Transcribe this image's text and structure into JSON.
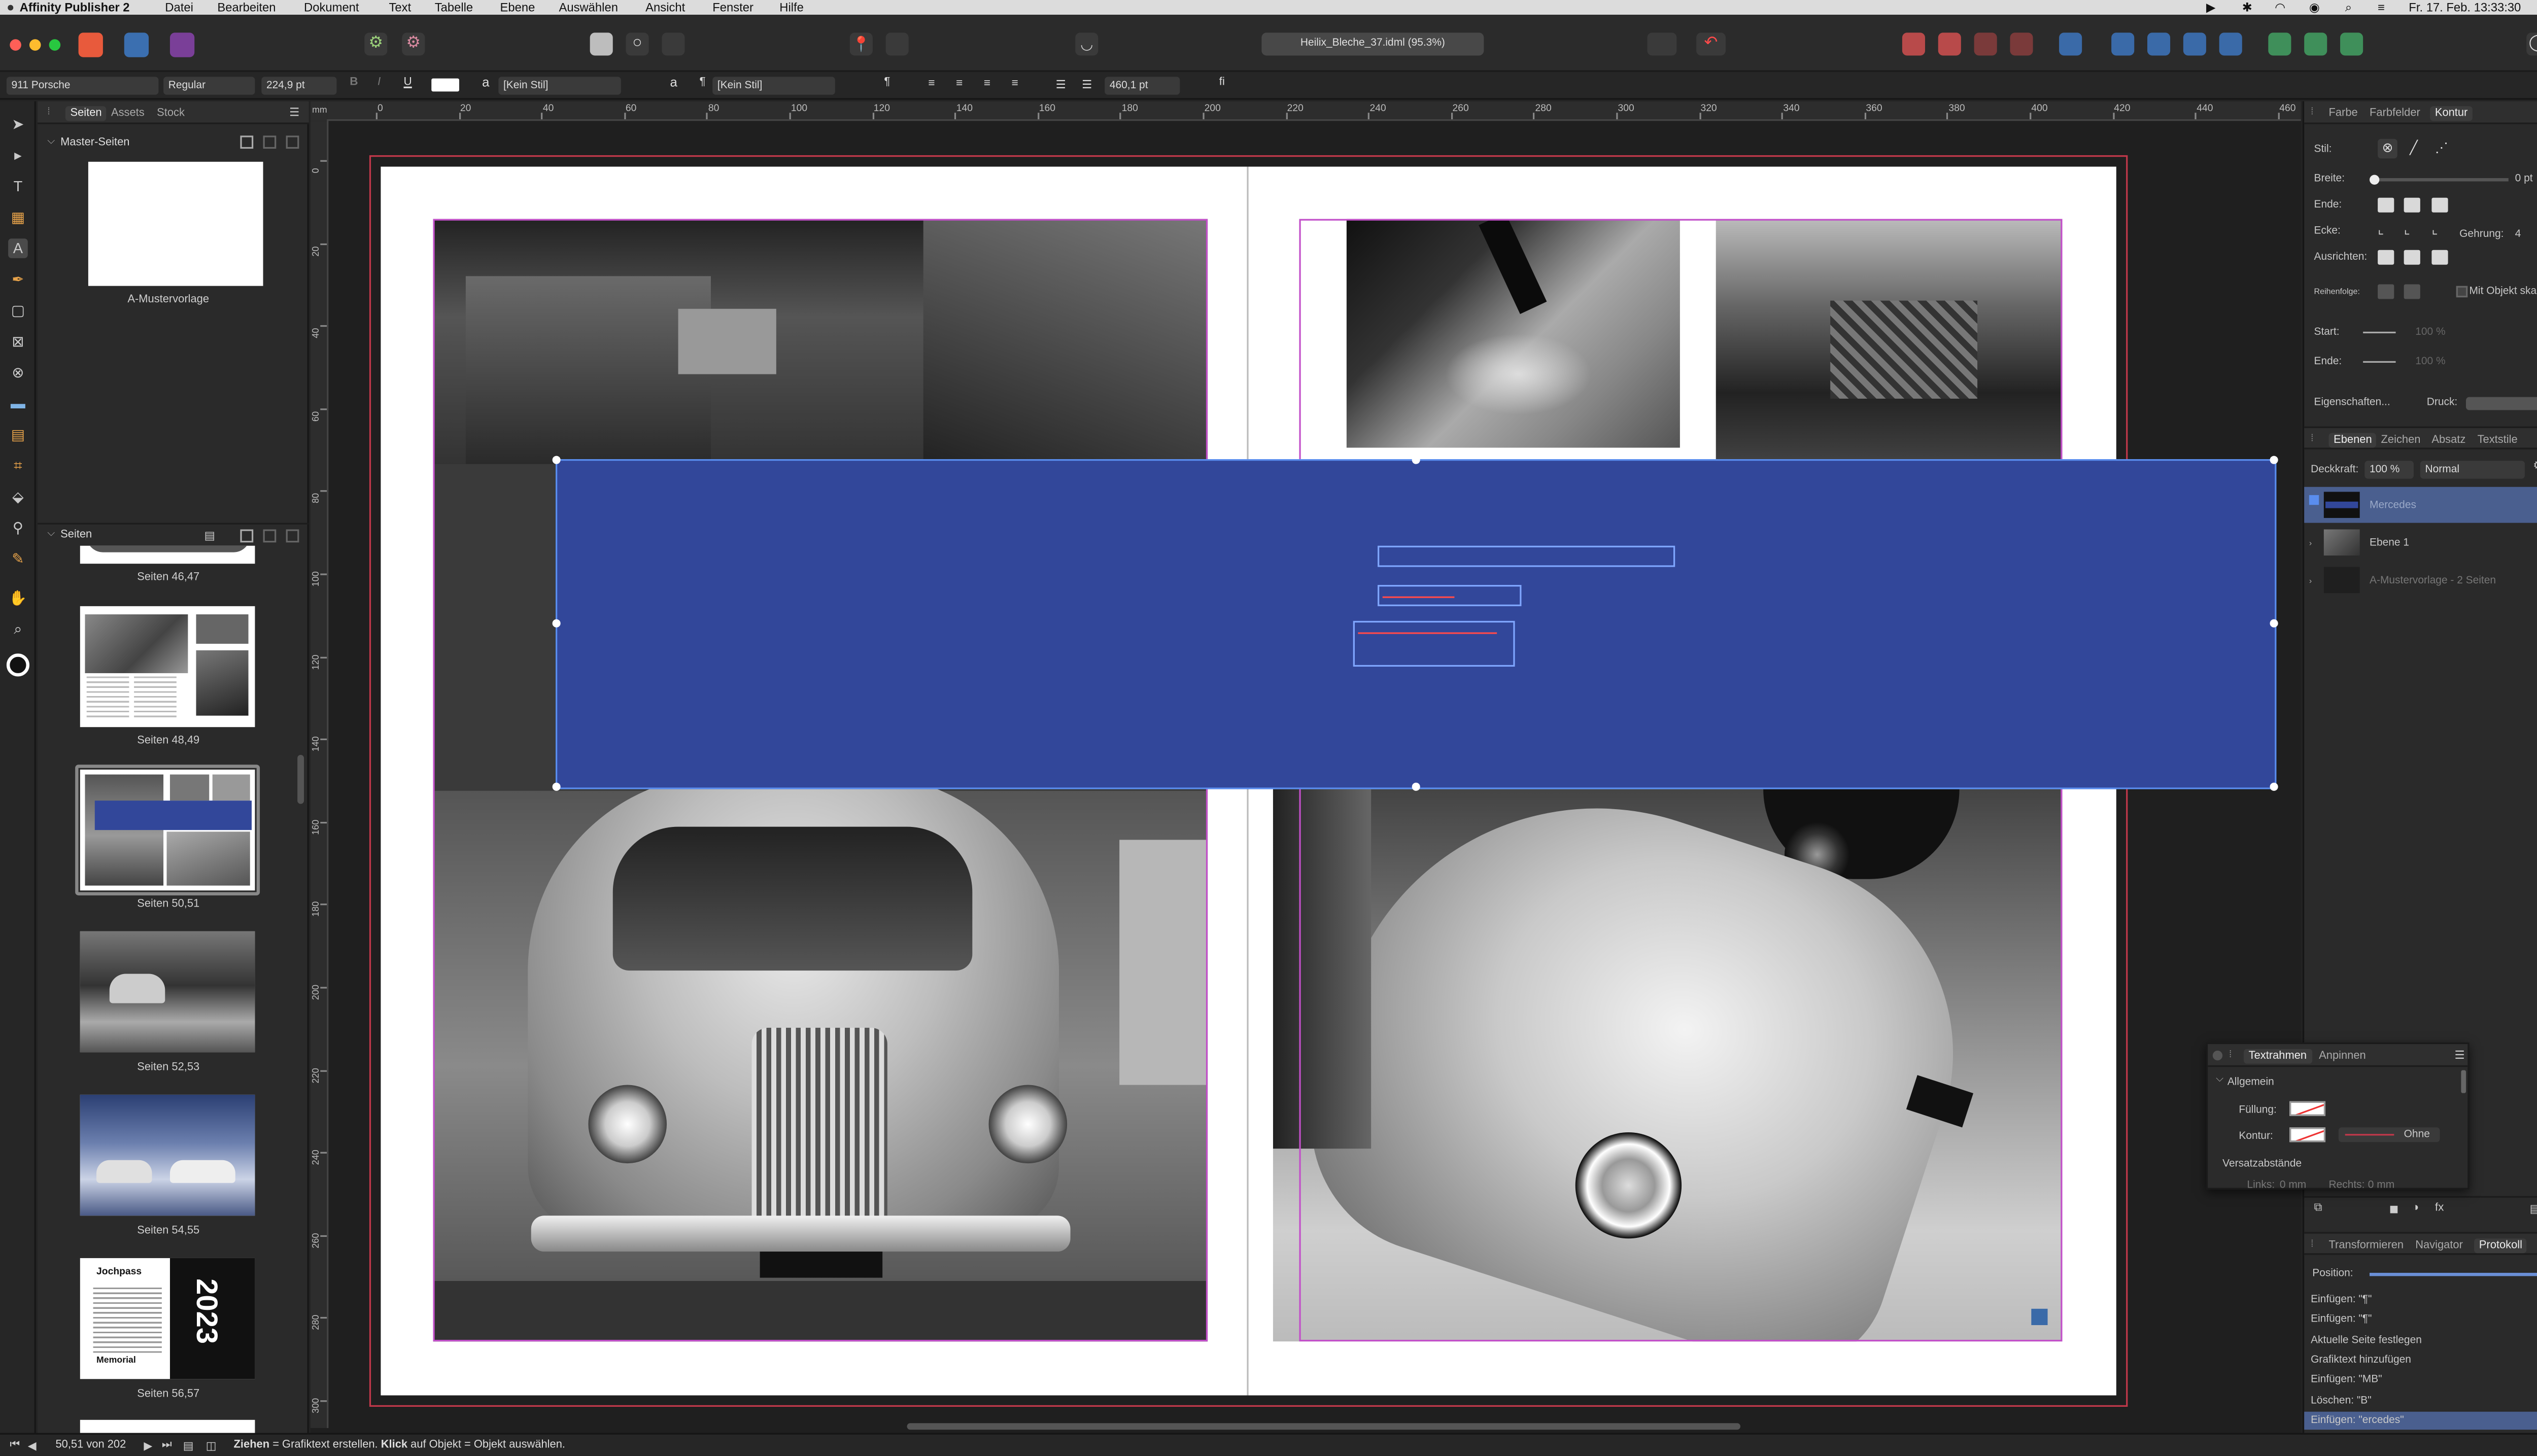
{
  "menubar": {
    "app_name": "Affinity Publisher 2",
    "items": [
      "Datei",
      "Bearbeiten",
      "Dokument",
      "Text",
      "Tabelle",
      "Ebene",
      "Auswählen",
      "Ansicht",
      "Fenster",
      "Hilfe"
    ],
    "clock": "Fr. 17. Feb.  13:33:30"
  },
  "toolbar": {
    "document_tab": "Heilix_Bleche_37.idml (95.3%)"
  },
  "context_bar": {
    "font_family": "911 Porsche",
    "font_style": "Regular",
    "font_size": "224,9 pt",
    "char_style": "[Kein Stil]",
    "para_style": "[Kein Stil]",
    "tracking": "460,1 pt",
    "bold": "B",
    "italic": "I",
    "underline": "U",
    "char_style_icon": "a",
    "para_icon": "¶",
    "ligature_label": "fi"
  },
  "left_panel": {
    "tabs": [
      "Seiten",
      "Assets",
      "Stock"
    ],
    "master_section": "Master-Seiten",
    "master_label": "A-Mustervorlage",
    "pages_section": "Seiten",
    "spreads": [
      {
        "label": "Seiten 46,47"
      },
      {
        "label": "Seiten 48,49"
      },
      {
        "label": "Seiten 50,51"
      },
      {
        "label": "Seiten 52,53"
      },
      {
        "label": "Seiten 54,55"
      },
      {
        "label": "Seiten 56,57"
      }
    ],
    "thumb_56_text": {
      "title": "Jochpass",
      "subtitle": "Memorial",
      "year": "2023"
    }
  },
  "rulers": {
    "h_ticks": [
      "0",
      "20",
      "40",
      "60",
      "80",
      "100",
      "120",
      "140",
      "160",
      "180",
      "200",
      "220",
      "240",
      "260",
      "280",
      "300",
      "320",
      "340",
      "360",
      "380",
      "400",
      "420",
      "440",
      "460"
    ],
    "v_ticks": [
      "0",
      "20",
      "40",
      "60",
      "80",
      "100",
      "120",
      "140",
      "160",
      "180",
      "200",
      "220",
      "240",
      "260",
      "280",
      "300"
    ],
    "unit": "mm"
  },
  "right_panel": {
    "top_tabs": [
      "Farbe",
      "Farbfelder",
      "Kontur"
    ],
    "stroke": {
      "stil": "Stil:",
      "breite": "Breite:",
      "breite_value": "0 pt",
      "ende": "Ende:",
      "ecke": "Ecke:",
      "gehrung": "Gehrung:",
      "gehrung_value": "4",
      "ausrichten": "Ausrichten:",
      "reihenfolge": "Reihenfolge:",
      "mit_objekt": "Mit Objekt skalieren",
      "start": "Start:",
      "start_pct": "100 %",
      "ende2": "Ende:",
      "ende_pct": "100 %",
      "eigenschaften": "Eigenschaften...",
      "druck": "Druck:"
    },
    "layer_tabs": [
      "Ebenen",
      "Zeichen",
      "Absatz",
      "Textstile"
    ],
    "opacity_label": "Deckkraft:",
    "opacity_value": "100 %",
    "blend_mode": "Normal",
    "layers": [
      "Mercedes",
      "Ebene 1",
      "A-Mustervorlage - 2 Seiten"
    ],
    "bottom_tabs": [
      "Transformieren",
      "Navigator",
      "Protokoll"
    ],
    "position_label": "Position:",
    "history": [
      "Einfügen: \"¶\"",
      "Einfügen: \"¶\"",
      "Aktuelle Seite festlegen",
      "Grafiktext hinzufügen",
      "Einfügen: \"MB\"",
      "Löschen: \"B\"",
      "Einfügen: \"ercedes\""
    ]
  },
  "text_frame_panel": {
    "tabs": [
      "Textrahmen",
      "Anpinnen"
    ],
    "section": "Allgemein",
    "fuellung": "Füllung:",
    "kontur": "Kontur:",
    "kontur_none": "Ohne",
    "versatz": "Versatzabstände",
    "links": "Links:",
    "links_val": "0 mm",
    "rechts": "Rechts:",
    "rechts_val": "0 mm"
  },
  "status_bar": {
    "page_info": "50,51 von 202",
    "hint_bold1": "Ziehen",
    "hint_text1": " = Grafiktext erstellen. ",
    "hint_bold2": "Klick",
    "hint_text2": " auf Objekt = Objekt auswählen."
  },
  "colors": {
    "blue_band": "#32479a",
    "app_bg": "#232323",
    "canvas_bg": "#1f1f1f",
    "margin_magenta": "#c24fc9",
    "bleed_red": "#c0384a",
    "selection_blue": "#5a8dee"
  }
}
